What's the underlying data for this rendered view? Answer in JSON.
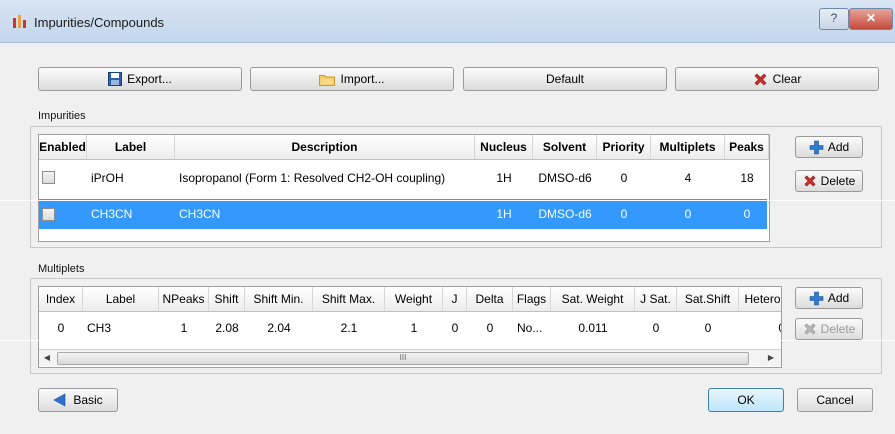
{
  "window": {
    "title": "Impurities/Compounds",
    "help_label": "?",
    "close_label": "✕"
  },
  "toolbar": {
    "export_label": "Export...",
    "import_label": "Import...",
    "default_label": "Default",
    "clear_label": "Clear"
  },
  "impurities": {
    "group_label": "Impurities",
    "columns": [
      "Enabled",
      "Label",
      "Description",
      "Nucleus",
      "Solvent",
      "Priority",
      "Multiplets",
      "Peaks"
    ],
    "rows": [
      {
        "enabled": false,
        "label": "iPrOH",
        "description": "Isopropanol (Form 1: Resolved CH2-OH coupling)",
        "nucleus": "1H",
        "solvent": "DMSO-d6",
        "priority": "0",
        "multiplets": "4",
        "peaks": "18",
        "selected": false
      },
      {
        "enabled": false,
        "label": "CH3CN",
        "description": "CH3CN",
        "nucleus": "1H",
        "solvent": "DMSO-d6",
        "priority": "0",
        "multiplets": "0",
        "peaks": "0",
        "selected": true
      }
    ],
    "add_label": "Add",
    "delete_label": "Delete"
  },
  "multiplets": {
    "group_label": "Multiplets",
    "columns": [
      "Index",
      "Label",
      "NPeaks",
      "Shift",
      "Shift Min.",
      "Shift Max.",
      "Weight",
      "J",
      "Delta",
      "Flags",
      "Sat. Weight",
      "J Sat.",
      "Sat.Shift",
      "Hetero"
    ],
    "rows": [
      {
        "index": "0",
        "label": "CH3",
        "npeaks": "1",
        "shift": "2.08",
        "shift_min": "2.04",
        "shift_max": "2.1",
        "weight": "1",
        "j": "0",
        "delta": "0",
        "flags": "No...",
        "sat_weight": "0.011",
        "j_sat": "0",
        "sat_shift": "0",
        "hetero": "0"
      }
    ],
    "add_label": "Add",
    "delete_label": "Delete",
    "scroll_thumb_label": "III"
  },
  "footer": {
    "basic_label": "Basic",
    "ok_label": "OK",
    "cancel_label": "Cancel"
  },
  "colors": {
    "selection": "#3399ff",
    "title_bar": "#c3d6ec",
    "close_button": "#c44b3b"
  }
}
